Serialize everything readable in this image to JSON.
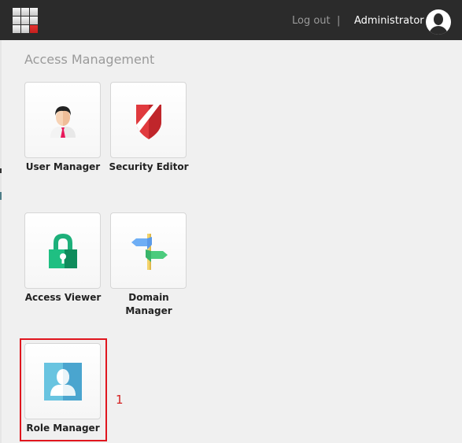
{
  "header": {
    "logout_label": "Log out",
    "separator": "|",
    "user_name": "Administrator",
    "app_menu_icon": "app-grid-icon",
    "avatar_icon": "user-avatar-icon"
  },
  "section": {
    "title": "Access Management"
  },
  "apps": [
    {
      "label": "User Manager",
      "icon": "user-manager-icon"
    },
    {
      "label": "Security Editor",
      "icon": "shield-icon"
    },
    {
      "label": "Access Viewer",
      "icon": "padlock-icon"
    },
    {
      "label": "Domain Manager",
      "icon": "signpost-icon"
    },
    {
      "label": "Role Manager",
      "icon": "role-person-icon"
    }
  ],
  "annotation": {
    "label": "1",
    "color": "#e0161e"
  }
}
